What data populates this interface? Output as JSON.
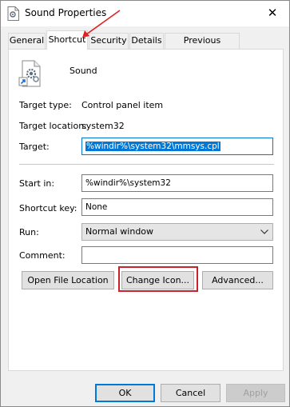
{
  "window": {
    "title": "Sound Properties"
  },
  "tabs": [
    {
      "label": "General"
    },
    {
      "label": "Shortcut",
      "active": true
    },
    {
      "label": "Security"
    },
    {
      "label": "Details"
    },
    {
      "label": "Previous Versions"
    }
  ],
  "shortcut": {
    "name": "Sound",
    "target_type_label": "Target type:",
    "target_type_value": "Control panel item",
    "target_location_label": "Target location:",
    "target_location_value": "system32",
    "target_label": "Target:",
    "target_value": "%windir%\\system32\\mmsys.cpl",
    "start_in_label": "Start in:",
    "start_in_value": "%windir%\\system32",
    "shortcut_key_label": "Shortcut key:",
    "shortcut_key_value": "None",
    "run_label": "Run:",
    "run_value": "Normal window",
    "comment_label": "Comment:",
    "comment_value": ""
  },
  "actions": {
    "open_file_location": "Open File Location",
    "change_icon": "Change Icon...",
    "advanced": "Advanced..."
  },
  "footer": {
    "ok": "OK",
    "cancel": "Cancel",
    "apply": "Apply"
  },
  "icons": {
    "window_icon": "document-gear-icon",
    "app_icon": "document-gear-shortcut-icon",
    "close": "close-icon",
    "dropdown": "chevron-down-icon"
  },
  "colors": {
    "selection": "#0078d7",
    "highlight_box": "#c8232c",
    "annotation_arrow": "#e02020"
  }
}
